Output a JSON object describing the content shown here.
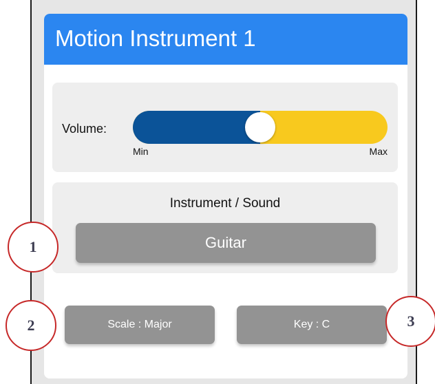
{
  "header": {
    "title": "Motion Instrument 1"
  },
  "volume": {
    "label": "Volume:",
    "min_label": "Min",
    "max_label": "Max",
    "level": 0.5
  },
  "instrument": {
    "heading": "Instrument / Sound",
    "selected": "Guitar"
  },
  "scale_button": {
    "label": "Scale : Major"
  },
  "key_button": {
    "label": "Key : C"
  },
  "callouts": [
    "1",
    "2",
    "3"
  ],
  "colors": {
    "header": "#2b86f0",
    "volume_filled": "#0b5398",
    "volume_empty": "#f8c91e",
    "button": "#939393",
    "panel": "#eeeeee",
    "callout_ring": "#c62828"
  }
}
